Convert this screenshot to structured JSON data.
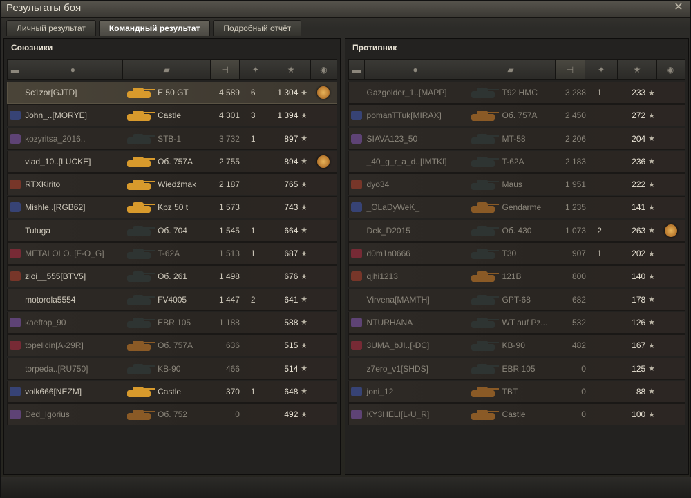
{
  "window": {
    "title": "Результаты боя",
    "close_icon": "close-icon"
  },
  "tabs": [
    {
      "label": "Личный результат",
      "active": false
    },
    {
      "label": "Командный результат",
      "active": true
    },
    {
      "label": "Подробный отчёт",
      "active": false
    }
  ],
  "colors": {
    "accent": "#d89a2c",
    "bg": "#232220"
  },
  "allies": {
    "title": "Союзники",
    "rows": [
      {
        "name": "Sc1zor[GJTD]",
        "tank": "E 50 GT",
        "xp": "4 589",
        "kills": "6",
        "score": "1 304",
        "medal": true,
        "me": true,
        "dim": false,
        "tone": "gold"
      },
      {
        "name": "John_..[MORYE]",
        "tank": "Castle",
        "xp": "4 301",
        "kills": "3",
        "score": "1 394",
        "medal": false,
        "me": false,
        "dim": false,
        "tone": "gold"
      },
      {
        "name": "kozyritsa_2016..",
        "tank": "STB-1",
        "xp": "3 732",
        "kills": "1",
        "score": "897",
        "medal": false,
        "me": false,
        "dim": true,
        "tone": "dark"
      },
      {
        "name": "vlad_10..[LUCKE]",
        "tank": "Об. 757А",
        "xp": "2 755",
        "kills": "",
        "score": "894",
        "medal": true,
        "me": false,
        "dim": false,
        "tone": "gold"
      },
      {
        "name": "RTXKirito",
        "tank": "Wiedźmak",
        "xp": "2 187",
        "kills": "",
        "score": "765",
        "medal": false,
        "me": false,
        "dim": false,
        "tone": "gold"
      },
      {
        "name": "Mishle..[RGB62]",
        "tank": "Kpz 50 t",
        "xp": "1 573",
        "kills": "",
        "score": "743",
        "medal": false,
        "me": false,
        "dim": false,
        "tone": "gold"
      },
      {
        "name": "Tutuga",
        "tank": "Об. 704",
        "xp": "1 545",
        "kills": "1",
        "score": "664",
        "medal": false,
        "me": false,
        "dim": false,
        "tone": "dark"
      },
      {
        "name": "METALOLO..[F-O_G]",
        "tank": "T-62A",
        "xp": "1 513",
        "kills": "1",
        "score": "687",
        "medal": false,
        "me": false,
        "dim": true,
        "tone": "dark"
      },
      {
        "name": "zloi__555[BTV5]",
        "tank": "Об. 261",
        "xp": "1 498",
        "kills": "",
        "score": "676",
        "medal": false,
        "me": false,
        "dim": false,
        "tone": "dark"
      },
      {
        "name": "motorola5554",
        "tank": "FV4005",
        "xp": "1 447",
        "kills": "2",
        "score": "641",
        "medal": false,
        "me": false,
        "dim": false,
        "tone": "dark"
      },
      {
        "name": "kaeftop_90",
        "tank": "EBR 105",
        "xp": "1 188",
        "kills": "",
        "score": "588",
        "medal": false,
        "me": false,
        "dim": true,
        "tone": "dark"
      },
      {
        "name": "topelicin[A-29R]",
        "tank": "Об. 757А",
        "xp": "636",
        "kills": "",
        "score": "515",
        "medal": false,
        "me": false,
        "dim": true,
        "tone": "bronze"
      },
      {
        "name": "torpeda..[RU750]",
        "tank": "KB-90",
        "xp": "466",
        "kills": "",
        "score": "514",
        "medal": false,
        "me": false,
        "dim": true,
        "tone": "dark"
      },
      {
        "name": "volk666[NEZM]",
        "tank": "Castle",
        "xp": "370",
        "kills": "1",
        "score": "648",
        "medal": false,
        "me": false,
        "dim": false,
        "tone": "gold"
      },
      {
        "name": "Ded_Igorius",
        "tank": "Об. 752",
        "xp": "0",
        "kills": "",
        "score": "492",
        "medal": false,
        "me": false,
        "dim": true,
        "tone": "bronze"
      }
    ]
  },
  "enemies": {
    "title": "Противник",
    "rows": [
      {
        "name": "Gazgolder_1..[MAPP]",
        "tank": "T92 HMC",
        "xp": "3 288",
        "kills": "1",
        "score": "233",
        "medal": false,
        "dim": true,
        "tone": "dark"
      },
      {
        "name": "pomanTTuk[MIRAX]",
        "tank": "Об. 757А",
        "xp": "2 450",
        "kills": "",
        "score": "272",
        "medal": false,
        "dim": true,
        "tone": "bronze"
      },
      {
        "name": "SIAVA123_50",
        "tank": "MT-58",
        "xp": "2 206",
        "kills": "",
        "score": "204",
        "medal": false,
        "dim": true,
        "tone": "dark"
      },
      {
        "name": "_40_g_r_a_d..[IMTKI]",
        "tank": "T-62A",
        "xp": "2 183",
        "kills": "",
        "score": "236",
        "medal": false,
        "dim": true,
        "tone": "dark"
      },
      {
        "name": "dyo34",
        "tank": "Maus",
        "xp": "1 951",
        "kills": "",
        "score": "222",
        "medal": false,
        "dim": true,
        "tone": "dark"
      },
      {
        "name": "_OLaDyWeK_",
        "tank": "Gendarme",
        "xp": "1 235",
        "kills": "",
        "score": "141",
        "medal": false,
        "dim": true,
        "tone": "bronze"
      },
      {
        "name": "Dek_D2015",
        "tank": "Об. 430",
        "xp": "1 073",
        "kills": "2",
        "score": "263",
        "medal": true,
        "dim": true,
        "tone": "dark"
      },
      {
        "name": "d0m1n0666",
        "tank": "T30",
        "xp": "907",
        "kills": "1",
        "score": "202",
        "medal": false,
        "dim": true,
        "tone": "dark"
      },
      {
        "name": "qjhi1213",
        "tank": "121B",
        "xp": "800",
        "kills": "",
        "score": "140",
        "medal": false,
        "dim": true,
        "tone": "bronze"
      },
      {
        "name": "Virvena[MAMTH]",
        "tank": "GPT-68",
        "xp": "682",
        "kills": "",
        "score": "178",
        "medal": false,
        "dim": true,
        "tone": "dark"
      },
      {
        "name": "NTURHANA",
        "tank": "WT auf Pz...",
        "xp": "532",
        "kills": "",
        "score": "126",
        "medal": false,
        "dim": true,
        "tone": "dark"
      },
      {
        "name": "3UMA_bJI..[-DC]",
        "tank": "KB-90",
        "xp": "482",
        "kills": "",
        "score": "167",
        "medal": false,
        "dim": true,
        "tone": "dark"
      },
      {
        "name": "z7ero_v1[SHDS]",
        "tank": "EBR 105",
        "xp": "0",
        "kills": "",
        "score": "125",
        "medal": false,
        "dim": true,
        "tone": "dark"
      },
      {
        "name": "joni_12",
        "tank": "TBT",
        "xp": "0",
        "kills": "",
        "score": "88",
        "medal": false,
        "dim": true,
        "tone": "bronze"
      },
      {
        "name": "KY3HELI[L-U_R]",
        "tank": "Castle",
        "xp": "0",
        "kills": "",
        "score": "100",
        "medal": false,
        "dim": true,
        "tone": "bronze"
      }
    ]
  },
  "header_icons": [
    "platoon-icon",
    "player-icon",
    "tank-icon",
    "damage-icon",
    "kills-icon",
    "score-icon",
    "medal-icon"
  ],
  "star_glyph": "★"
}
